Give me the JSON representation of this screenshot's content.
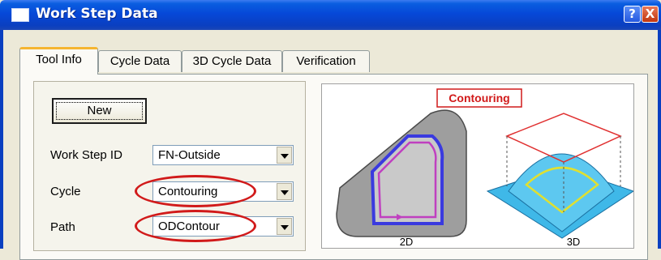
{
  "window": {
    "title": "Work Step Data",
    "help_icon": "?",
    "close_icon": "X",
    "app_icon": "window-icon"
  },
  "tabs": [
    {
      "label": "Tool Info",
      "active": true
    },
    {
      "label": "Cycle Data",
      "active": false
    },
    {
      "label": "3D Cycle Data",
      "active": false
    },
    {
      "label": "Verification",
      "active": false
    }
  ],
  "form": {
    "new_button": "New",
    "work_step_id": {
      "label": "Work Step ID",
      "value": "FN-Outside"
    },
    "cycle": {
      "label": "Cycle",
      "value": "Contouring"
    },
    "path": {
      "label": "Path",
      "value": "ODContour"
    }
  },
  "preview": {
    "title": "Contouring",
    "caption_2d": "2D",
    "caption_3d": "3D"
  },
  "colors": {
    "highlight": "#d11a1a",
    "surface_3d": "#3fb8e8",
    "path_2d": "#3a3adf",
    "contour_2d": "#c040c0"
  }
}
